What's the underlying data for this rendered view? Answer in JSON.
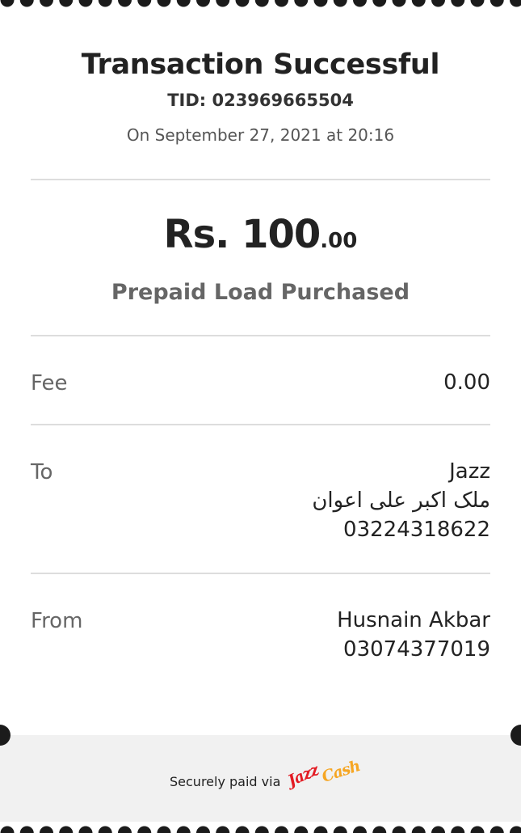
{
  "receipt": {
    "title": "Transaction Successful",
    "tid": "TID: 023969665504",
    "datetime": "On September 27, 2021 at 20:16",
    "amount_main": "Rs. 100",
    "amount_cents": ".00",
    "description": "Prepaid Load Purchased"
  },
  "details": {
    "fee": {
      "label": "Fee",
      "value": "0.00"
    },
    "to": {
      "label": "To",
      "network": "Jazz",
      "name": "ملک اکبر علی اعوان",
      "number": "03224318622"
    },
    "from": {
      "label": "From",
      "name": "Husnain Akbar",
      "number": "03074377019"
    }
  },
  "footer": {
    "secure_text": "Securely paid via",
    "logo_text": "JazzCash",
    "logo_icon": "jazzcash-logo"
  },
  "colors": {
    "background": "#ffffff",
    "footer_bg": "#f1f1f1",
    "scallop": "#1b1b1b",
    "divider": "#dddddd",
    "jazz_red": "#e31b23",
    "cash_orange": "#f6a623"
  }
}
